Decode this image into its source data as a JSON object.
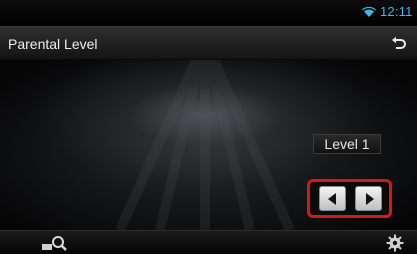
{
  "status_bar": {
    "time": "12:11",
    "wifi_icon": "wifi-icon",
    "accent_color": "#3fb7e9"
  },
  "header": {
    "title": "Parental Level",
    "back_icon": "back-return-icon"
  },
  "main": {
    "level_label": "Level 1",
    "left_icon": "triangle-left-icon",
    "right_icon": "triangle-right-icon",
    "highlight_color": "#d21a1a"
  },
  "bottom_bar": {
    "search_icon": "search-icon",
    "settings_icon": "gear-icon"
  }
}
